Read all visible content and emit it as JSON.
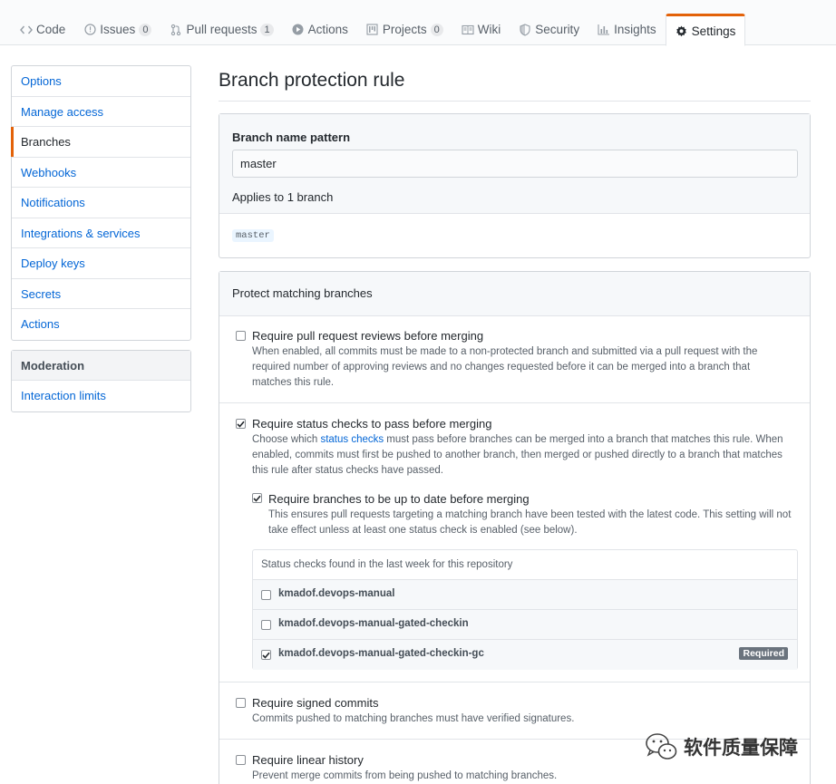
{
  "tabs": [
    {
      "label": "Code",
      "icon": "code-icon"
    },
    {
      "label": "Issues",
      "icon": "issue-icon",
      "count": "0"
    },
    {
      "label": "Pull requests",
      "icon": "pull-request-icon",
      "count": "1"
    },
    {
      "label": "Actions",
      "icon": "play-icon"
    },
    {
      "label": "Projects",
      "icon": "project-icon",
      "count": "0"
    },
    {
      "label": "Wiki",
      "icon": "book-icon"
    },
    {
      "label": "Security",
      "icon": "shield-icon"
    },
    {
      "label": "Insights",
      "icon": "graph-icon"
    },
    {
      "label": "Settings",
      "icon": "gear-icon",
      "selected": true
    }
  ],
  "sidebar": {
    "items": [
      {
        "label": "Options"
      },
      {
        "label": "Manage access"
      },
      {
        "label": "Branches",
        "selected": true
      },
      {
        "label": "Webhooks"
      },
      {
        "label": "Notifications"
      },
      {
        "label": "Integrations & services"
      },
      {
        "label": "Deploy keys"
      },
      {
        "label": "Secrets"
      },
      {
        "label": "Actions"
      }
    ],
    "moderation_heading": "Moderation",
    "moderation_items": [
      {
        "label": "Interaction limits"
      }
    ]
  },
  "main": {
    "title": "Branch protection rule",
    "pattern_label": "Branch name pattern",
    "pattern_value": "master",
    "applies_text": "Applies to 1 branch",
    "branch_chip": "master",
    "protect_heading": "Protect matching branches",
    "options": {
      "reviews": {
        "title": "Require pull request reviews before merging",
        "desc": "When enabled, all commits must be made to a non-protected branch and submitted via a pull request with the required number of approving reviews and no changes requested before it can be merged into a branch that matches this rule.",
        "checked": false
      },
      "status": {
        "title": "Require status checks to pass before merging",
        "desc_pre": "Choose which ",
        "desc_link": "status checks",
        "desc_post": " must pass before branches can be merged into a branch that matches this rule. When enabled, commits must first be pushed to another branch, then merged or pushed directly to a branch that matches this rule after status checks have passed.",
        "checked": true
      },
      "uptodate": {
        "title": "Require branches to be up to date before merging",
        "desc": "This ensures pull requests targeting a matching branch have been tested with the latest code. This setting will not take effect unless at least one status check is enabled (see below).",
        "checked": true
      },
      "signed": {
        "title": "Require signed commits",
        "desc": "Commits pushed to matching branches must have verified signatures.",
        "checked": false
      },
      "linear": {
        "title": "Require linear history",
        "desc": "Prevent merge commits from being pushed to matching branches.",
        "checked": false
      }
    },
    "status_checks": {
      "heading": "Status checks found in the last week for this repository",
      "items": [
        {
          "name": "kmadof.devops-manual",
          "checked": false
        },
        {
          "name": "kmadof.devops-manual-gated-checkin",
          "checked": false
        },
        {
          "name": "kmadof.devops-manual-gated-checkin-gc",
          "checked": true,
          "badge": "Required"
        }
      ]
    }
  },
  "watermark": {
    "text": "软件质量保障",
    "icon": "wechat-icon"
  },
  "colors": {
    "accent": "#e36209",
    "link": "#0366d6",
    "border": "#d1d5da"
  }
}
